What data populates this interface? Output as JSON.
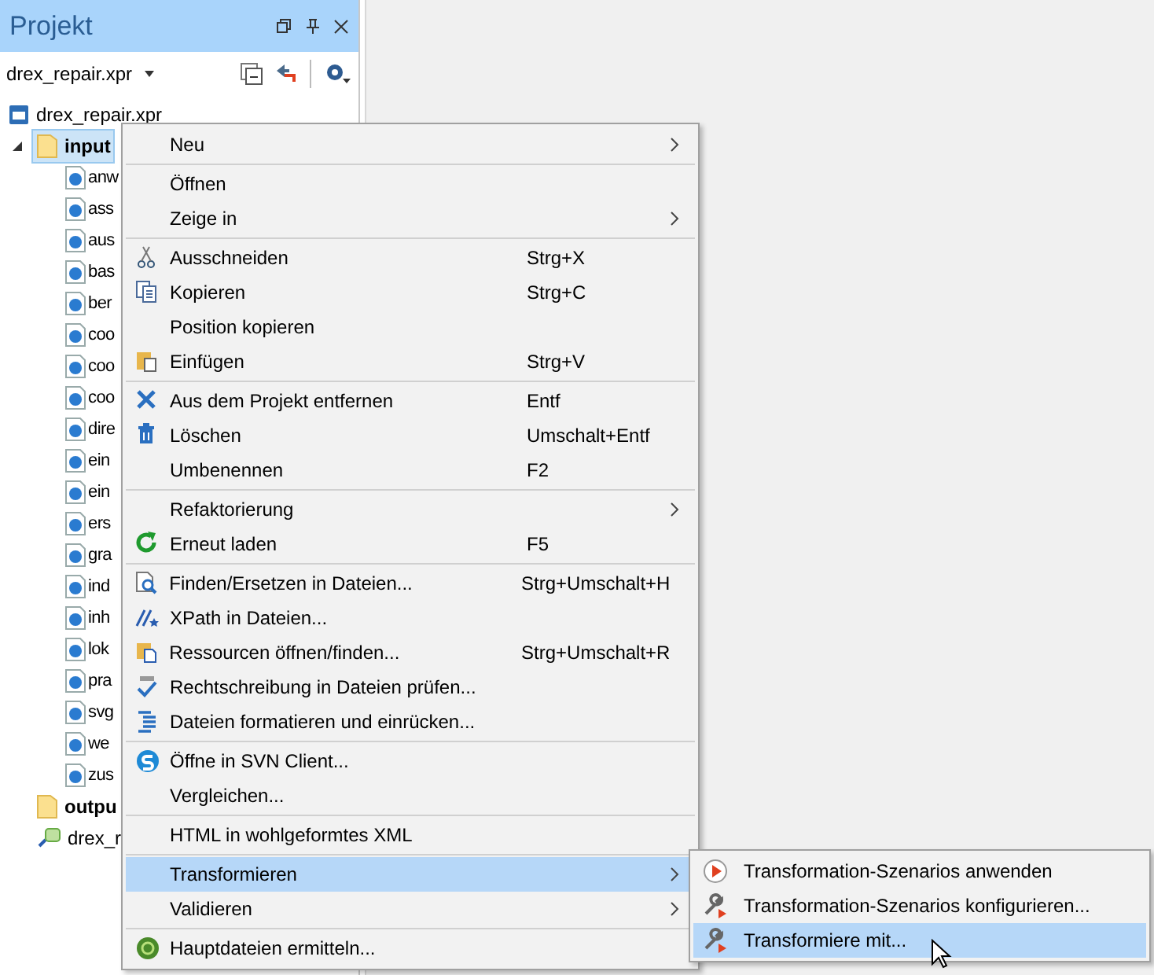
{
  "panel": {
    "title": "Projekt",
    "project_selector": "drex_repair.xpr"
  },
  "tree": [
    {
      "label": "drex_repair.xpr",
      "kind": "project",
      "selected": false
    },
    {
      "label": "input",
      "kind": "folder",
      "selected": true,
      "expanded": true,
      "children": [
        {
          "label": "anw",
          "kind": "file"
        },
        {
          "label": "ass",
          "kind": "file"
        },
        {
          "label": "aus",
          "kind": "file"
        },
        {
          "label": "bas",
          "kind": "file"
        },
        {
          "label": "ber",
          "kind": "file"
        },
        {
          "label": "coo",
          "kind": "file"
        },
        {
          "label": "coo",
          "kind": "file"
        },
        {
          "label": "coo",
          "kind": "file"
        },
        {
          "label": "dire",
          "kind": "file"
        },
        {
          "label": "ein",
          "kind": "file"
        },
        {
          "label": "ein",
          "kind": "file"
        },
        {
          "label": "ers",
          "kind": "file"
        },
        {
          "label": "gra",
          "kind": "file"
        },
        {
          "label": "ind",
          "kind": "file"
        },
        {
          "label": "inh",
          "kind": "file"
        },
        {
          "label": "lok",
          "kind": "file"
        },
        {
          "label": "pra",
          "kind": "file"
        },
        {
          "label": "svg",
          "kind": "file"
        },
        {
          "label": "we",
          "kind": "file"
        },
        {
          "label": "zus",
          "kind": "file"
        }
      ]
    },
    {
      "label": "outpu",
      "kind": "folder",
      "selected": false
    },
    {
      "label": "drex_r",
      "kind": "xpr",
      "selected": false
    }
  ],
  "context_menu": [
    {
      "kind": "plain",
      "label": "Neu",
      "submenu": true,
      "selected": false
    },
    {
      "kind": "separator"
    },
    {
      "kind": "plain",
      "label": "Öffnen",
      "submenu": false,
      "selected": false
    },
    {
      "kind": "plain",
      "label": "Zeige in",
      "submenu": true,
      "selected": false
    },
    {
      "kind": "separator"
    },
    {
      "kind": "scissors",
      "label": "Ausschneiden",
      "shortcut": "Strg+X",
      "submenu": false,
      "selected": false
    },
    {
      "kind": "copy",
      "label": "Kopieren",
      "shortcut": "Strg+C",
      "submenu": false,
      "selected": false
    },
    {
      "kind": "plain",
      "label": "Position kopieren",
      "submenu": false,
      "selected": false
    },
    {
      "kind": "paste",
      "label": "Einfügen",
      "shortcut": "Strg+V",
      "submenu": false,
      "selected": false
    },
    {
      "kind": "separator"
    },
    {
      "kind": "cross",
      "label": "Aus dem Projekt entfernen",
      "shortcut": "Entf",
      "submenu": false,
      "selected": false
    },
    {
      "kind": "trash",
      "label": "Löschen",
      "shortcut": "Umschalt+Entf",
      "submenu": false,
      "selected": false
    },
    {
      "kind": "plain",
      "label": "Umbenennen",
      "shortcut": "F2",
      "submenu": false,
      "selected": false
    },
    {
      "kind": "separator"
    },
    {
      "kind": "plain",
      "label": "Refaktorierung",
      "submenu": true,
      "selected": false
    },
    {
      "kind": "reload",
      "label": "Erneut laden",
      "shortcut": "F5",
      "submenu": false,
      "selected": false
    },
    {
      "kind": "separator"
    },
    {
      "kind": "find",
      "label": "Finden/Ersetzen in Dateien...",
      "shortcut": "Strg+Umschalt+H",
      "submenu": false,
      "selected": false
    },
    {
      "kind": "xpath",
      "label": "XPath in Dateien...",
      "submenu": false,
      "selected": false
    },
    {
      "kind": "resources",
      "label": "Ressourcen öffnen/finden...",
      "shortcut": "Strg+Umschalt+R",
      "submenu": false,
      "selected": false
    },
    {
      "kind": "spell",
      "label": "Rechtschreibung in Dateien prüfen...",
      "submenu": false,
      "selected": false
    },
    {
      "kind": "indent",
      "label": "Dateien formatieren und einrücken...",
      "submenu": false,
      "selected": false
    },
    {
      "kind": "separator"
    },
    {
      "kind": "svn",
      "label": "Öffne in SVN Client...",
      "submenu": false,
      "selected": false
    },
    {
      "kind": "plain",
      "label": "Vergleichen...",
      "submenu": false,
      "selected": false
    },
    {
      "kind": "separator"
    },
    {
      "kind": "plain",
      "label": "HTML in wohlgeformtes XML",
      "submenu": false,
      "selected": false
    },
    {
      "kind": "separator"
    },
    {
      "kind": "plain",
      "label": "Transformieren",
      "submenu": true,
      "selected": true
    },
    {
      "kind": "plain",
      "label": "Validieren",
      "submenu": true,
      "selected": false
    },
    {
      "kind": "separator"
    },
    {
      "kind": "main",
      "label": "Hauptdateien ermitteln...",
      "submenu": false,
      "selected": false
    }
  ],
  "submenu": [
    {
      "kind": "play",
      "label": "Transformation-Szenarios anwenden",
      "selected": false
    },
    {
      "kind": "wrench",
      "label": "Transformation-Szenarios konfigurieren...",
      "selected": false
    },
    {
      "kind": "wrench",
      "label": "Transformiere mit...",
      "selected": true
    }
  ]
}
